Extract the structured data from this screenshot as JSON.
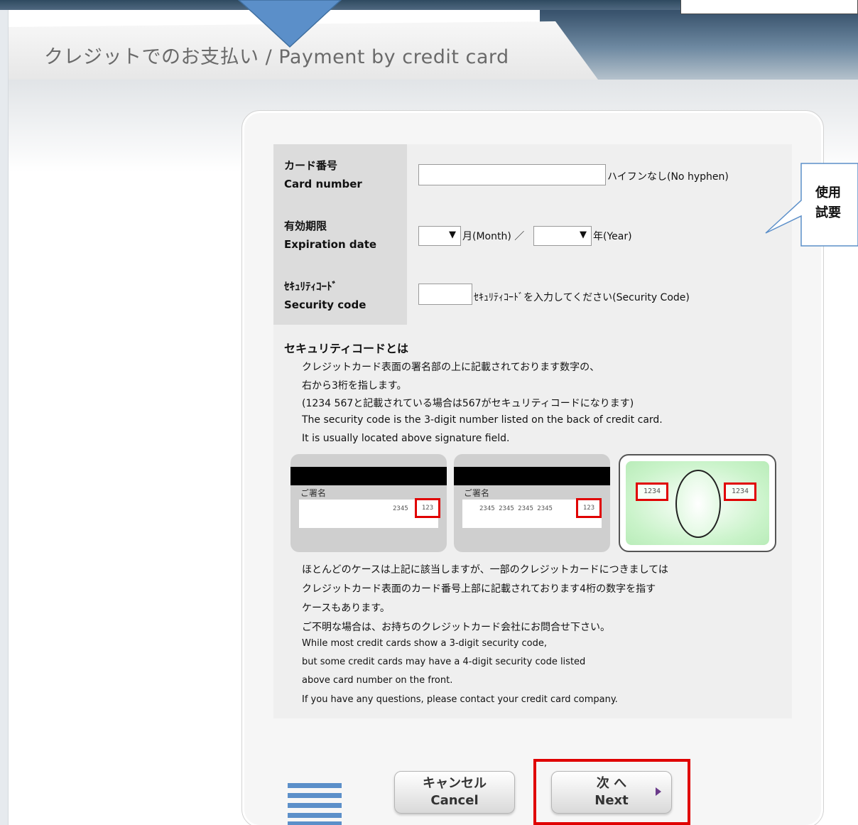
{
  "header": {
    "title": "クレジットでのお支払い / Payment by credit card"
  },
  "form": {
    "card_number": {
      "label_jp": "カード番号",
      "label_en": "Card number",
      "value": "",
      "hint": "ハイフンなし(No hyphen)"
    },
    "expiration": {
      "label_jp": "有効期限",
      "label_en": "Expiration date",
      "month_value": "",
      "month_suffix": "月(Month) ／",
      "year_value": "",
      "year_suffix": "年(Year)",
      "caret": "▼"
    },
    "security_code": {
      "label_jp": "ｾｷｭﾘﾃｨｺｰﾄﾞ",
      "label_en": "Security code",
      "value": "",
      "hint": "ｾｷｭﾘﾃｨｺｰﾄﾞを入力してください(Security Code)"
    }
  },
  "security_info": {
    "title": "セキュリティコードとは",
    "lines_top": [
      "クレジットカード表面の署名部の上に記載されております数字の、",
      "右から3桁を指します。",
      "(1234 567と記載されている場合は567がセキュリティコードになります)",
      "The security code is the 3-digit number listed on the back of credit card.",
      "It is usually located above signature field."
    ],
    "cards": {
      "signature_label": "ご署名",
      "card1_numbers": "2345",
      "card1_code": "123",
      "card2_numbers": "2345 2345 2345 2345",
      "card2_code": "123",
      "card3_code_left": "1234",
      "card3_code_right": "1234"
    },
    "lines_bottom": [
      "ほとんどのケースは上記に該当しますが、一部のクレジットカードにつきましては",
      "クレジットカード表面のカード番号上部に記載されております4桁の数字を指す",
      "ケースもあります。",
      "ご不明な場合は、お持ちのクレジットカード会社にお問合せ下さい。",
      "While most credit cards show a 3-digit security code,",
      "but some credit cards may have a 4-digit security code listed",
      "above card number on the front.",
      "If you have any questions, please contact your credit card company."
    ]
  },
  "buttons": {
    "cancel_jp": "キャンセル",
    "cancel_en": "Cancel",
    "next_jp": "次 へ",
    "next_en": "Next"
  },
  "annotation": {
    "line1": "使用",
    "line2": "試要"
  },
  "colors": {
    "highlight_red": "#e00000",
    "callout_blue": "#5b8fc9",
    "header_dark": "#36506a"
  }
}
